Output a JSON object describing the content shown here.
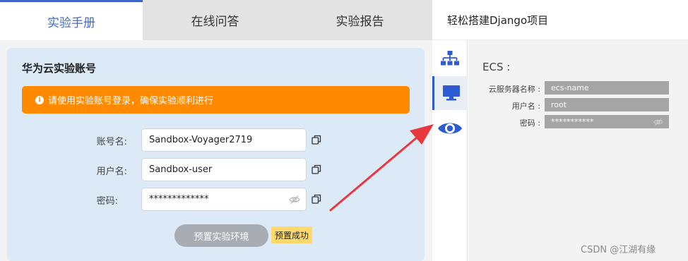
{
  "tabs": [
    {
      "label": "实验手册",
      "active": true
    },
    {
      "label": "在线问答",
      "active": false
    },
    {
      "label": "实验报告",
      "active": false
    }
  ],
  "right_title": "轻松搭建Django项目",
  "account_panel": {
    "title": "华为云实验账号",
    "alert": "请使用实验账号登录，确保实验顺利进行",
    "fields": [
      {
        "label": "账号名:",
        "value": "Sandbox-Voyager2719"
      },
      {
        "label": "用户名:",
        "value": "Sandbox-user"
      },
      {
        "label": "密码:",
        "value": "*************"
      }
    ],
    "preset_button": "预置实验环境",
    "success_tag": "预置成功"
  },
  "ecs": {
    "title": "ECS :",
    "rows": [
      {
        "label": "云服务器名称 :",
        "value": "ecs-name"
      },
      {
        "label": "用户名 :",
        "value": "root"
      },
      {
        "label": "密码 :",
        "value": "***********"
      }
    ]
  },
  "icons": {
    "sidebar": [
      "sitemap-icon",
      "monitor-icon",
      "eye-icon"
    ]
  },
  "colors": {
    "accent": "#2d5bd4",
    "alert": "#ff8a00",
    "panel": "#dce9f7",
    "arrow": "#e8383d"
  },
  "watermark": "CSDN @江湖有缘"
}
